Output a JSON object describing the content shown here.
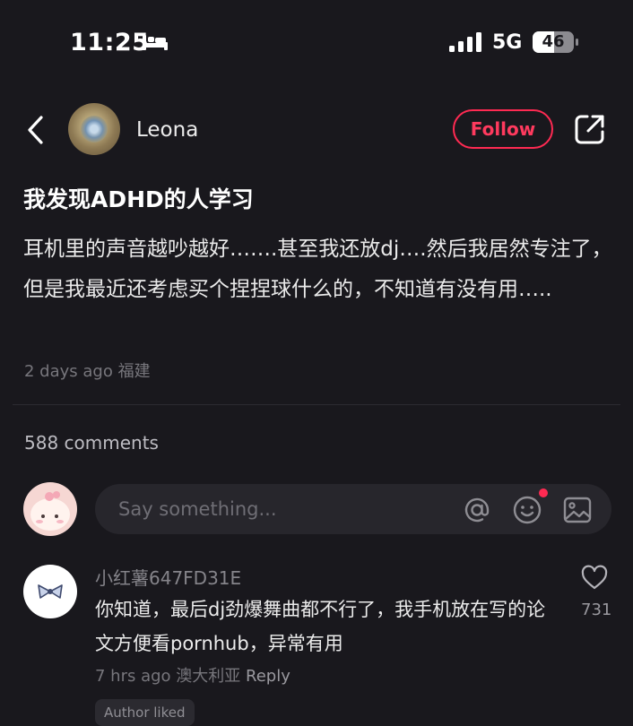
{
  "status_bar": {
    "time": "11:25",
    "network": "5G",
    "battery": "46"
  },
  "header": {
    "username": "Leona",
    "follow_label": "Follow"
  },
  "post": {
    "title": "我发现ADHD的人学习",
    "body": "耳机里的声音越吵越好…….甚至我还放dj….然后我居然专注了，但是我最近还考虑买个捏捏球什么的，不知道有没有用…..",
    "time": "2 days ago",
    "location": "福建"
  },
  "comments_section": {
    "count_label": "588 comments",
    "input_placeholder": "Say something..."
  },
  "comments": [
    {
      "author": "小红薯647FD31E",
      "text": "你知道，最后dj劲爆舞曲都不行了，我手机放在写的论文方便看pornhub，异常有用",
      "time": "7 hrs ago",
      "location": "澳大利亚",
      "reply_label": "Reply",
      "likes": "731",
      "badge": "Author liked"
    }
  ],
  "colors": {
    "background": "#19181d",
    "accent": "#ff2a52",
    "muted_text": "#77767c"
  },
  "icons": [
    "bed-icon",
    "signal-icon",
    "battery-icon",
    "back-icon",
    "share-icon",
    "at-icon",
    "emoji-icon",
    "image-icon",
    "heart-icon",
    "bow-icon"
  ]
}
